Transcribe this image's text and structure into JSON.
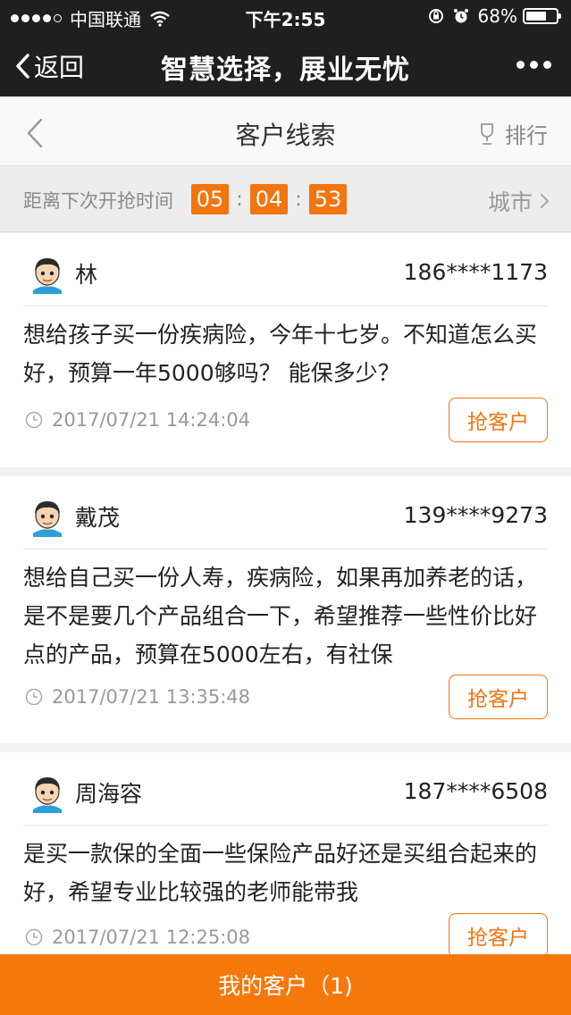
{
  "status_bar": {
    "carrier": "中国联通",
    "time": "下午2:55",
    "battery": "68%",
    "battery_level": 0.68
  },
  "nav": {
    "back_label": "返回",
    "title": "智慧选择，展业无忧"
  },
  "page": {
    "title": "客户线索",
    "rank_label": "排行"
  },
  "timer": {
    "label": "距离下次开抢时间",
    "hours": "05",
    "minutes": "04",
    "seconds": "53",
    "city_label": "城市"
  },
  "leads": [
    {
      "name": "林",
      "phone": "186****1173",
      "text": "想给孩子买一份疾病险，今年十七岁。不知道怎么买好，预算一年5000够吗？ 能保多少？",
      "time": "2017/07/21 14:24:04",
      "button": "抢客户"
    },
    {
      "name": "戴茂",
      "phone": "139****9273",
      "text": "想给自己买一份人寿，疾病险，如果再加养老的话，是不是要几个产品组合一下，希望推荐一些性价比好点的产品，预算在5000左右，有社保",
      "time": "2017/07/21 13:35:48",
      "button": "抢客户"
    },
    {
      "name": "周海容",
      "phone": "187****6508",
      "text": "是买一款保的全面一些保险产品好还是买组合起来的好，希望专业比较强的老师能带我",
      "time": "2017/07/21 12:25:08",
      "button": "抢客户"
    }
  ],
  "bottom_bar": {
    "label": "我的客户（1)"
  },
  "colors": {
    "accent": "#f2750f",
    "bottom_bar": "#f6780a",
    "dark_bar": "#1f1f1f"
  }
}
